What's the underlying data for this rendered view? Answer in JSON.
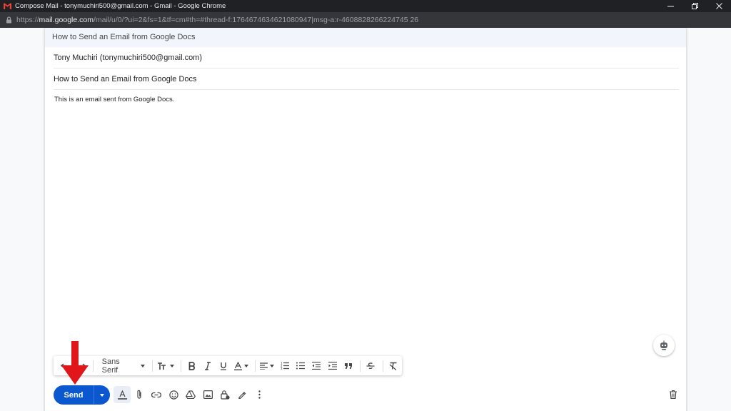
{
  "window": {
    "title": "Compose Mail - tonymuchiri500@gmail.com - Gmail - Google Chrome",
    "buttons": [
      "minimize",
      "restore",
      "close"
    ]
  },
  "address_bar": {
    "scheme": "https://",
    "host": "mail.google.com",
    "path": "/mail/u/0/?ui=2&fs=1&tf=cm#th=#thread-f:1764674634621080947|msg-a:r-4608828266224745 26"
  },
  "compose": {
    "header_title": "How to Send an Email from Google Docs",
    "to_value": "Tony Muchiri (tonymuchiri500@gmail.com)",
    "subject_value": "How to Send an Email from Google Docs",
    "body_text": "This is an email sent from Google Docs."
  },
  "format_toolbar": {
    "font_family": "Sans Serif"
  },
  "actions": {
    "send_label": "Send"
  },
  "colors": {
    "send_blue": "#0b57d0",
    "arrow_red": "#e0161b",
    "titlebar": "#202124",
    "addressbar": "#35363a",
    "header_bg": "#f2f6fc"
  },
  "icons": {
    "format_toolbar": [
      "undo-icon",
      "redo-icon",
      "font-size-icon",
      "bold-icon",
      "italic-icon",
      "underline-icon",
      "text-color-icon",
      "align-icon",
      "numbered-list-icon",
      "bulleted-list-icon",
      "indent-less-icon",
      "indent-more-icon",
      "quote-icon",
      "strikethrough-icon",
      "remove-formatting-icon"
    ],
    "bottom_bar": [
      "formatting-options-icon",
      "attach-icon",
      "link-icon",
      "emoji-icon",
      "drive-icon",
      "photo-icon",
      "confidential-icon",
      "signature-icon",
      "more-options-icon",
      "trash-icon"
    ]
  }
}
